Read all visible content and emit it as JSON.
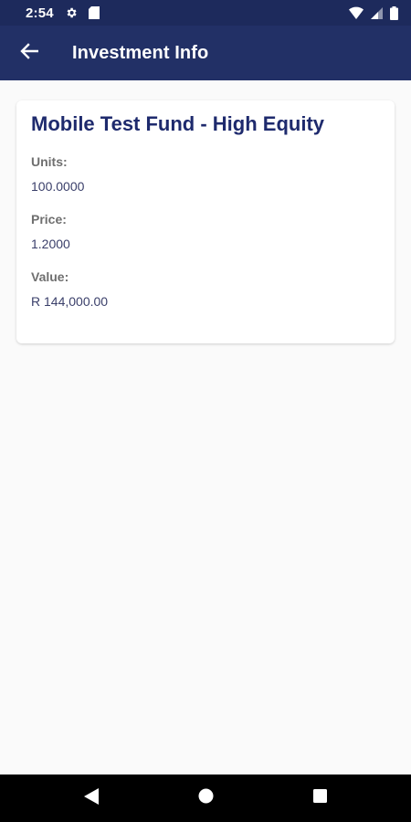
{
  "status_bar": {
    "time": "2:54",
    "icons": [
      "settings-icon",
      "sd-card-icon",
      "wifi-icon",
      "signal-icon",
      "battery-icon"
    ]
  },
  "app_bar": {
    "title": "Investment Info",
    "back_icon": "arrow-back-icon"
  },
  "card": {
    "fund_name": "Mobile Test Fund - High Equity",
    "fields": [
      {
        "label": "Units:",
        "value": "100.0000"
      },
      {
        "label": "Price:",
        "value": "1.2000"
      },
      {
        "label": "Value:",
        "value": "R 144,000.00"
      }
    ]
  },
  "nav_bar": {
    "buttons": [
      "back-triangle-icon",
      "home-circle-icon",
      "recents-square-icon"
    ]
  },
  "colors": {
    "status_bar": "#1d2a5c",
    "app_bar": "#223066",
    "title_text": "#1e2a6d",
    "label_text": "#6f6f6f",
    "value_text": "#3a3f6a",
    "background": "#fafafa"
  }
}
